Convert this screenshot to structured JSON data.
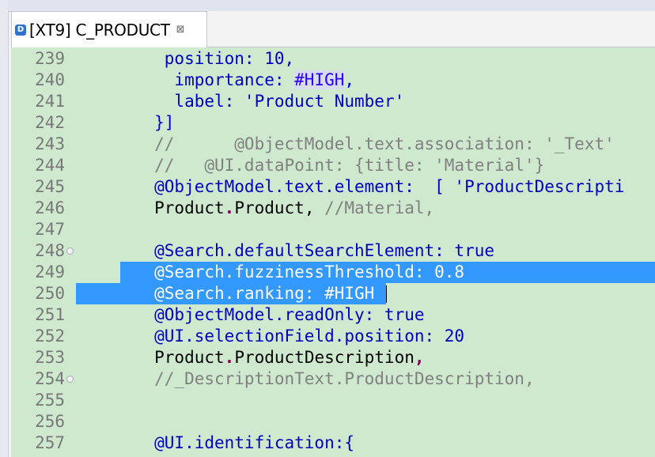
{
  "editor_tab": {
    "icon": "D",
    "icon_name": "ddl-source-icon",
    "title": "[XT9] C_PRODUCT",
    "close_glyph": "⊠"
  },
  "colors": {
    "editor_background": "#cfe9cf",
    "selection": "#3399ff",
    "keyword": "#2a00ff",
    "comment": "#808080",
    "line_number": "#787878"
  },
  "lines": [
    {
      "n": "239",
      "fold": false,
      "tokens": [
        {
          "t": "         position: 10,",
          "c": "t-kw"
        }
      ]
    },
    {
      "n": "240",
      "fold": false,
      "tokens": [
        {
          "t": "          importance: ",
          "c": "t-kw"
        },
        {
          "t": "#HIGH",
          "c": "t-enum"
        },
        {
          "t": ",",
          "c": "t-kw"
        }
      ]
    },
    {
      "n": "241",
      "fold": false,
      "tokens": [
        {
          "t": "          label: 'Product Number'",
          "c": "t-kw"
        }
      ]
    },
    {
      "n": "242",
      "fold": false,
      "tokens": [
        {
          "t": "        }]",
          "c": "t-kw"
        }
      ]
    },
    {
      "n": "243",
      "fold": false,
      "tokens": [
        {
          "t": "        //      @ObjectModel.text.association: '_Text'",
          "c": "t-com"
        }
      ]
    },
    {
      "n": "244",
      "fold": false,
      "tokens": [
        {
          "t": "        //   @UI.dataPoint: {title: 'Material'}",
          "c": "t-com"
        }
      ]
    },
    {
      "n": "245",
      "fold": false,
      "tokens": [
        {
          "t": "        @ObjectModel.text.element:  [ 'ProductDescripti",
          "c": "t-kw"
        }
      ]
    },
    {
      "n": "246",
      "fold": false,
      "tokens": [
        {
          "t": "        Product",
          "c": "t-plain"
        },
        {
          "t": ".",
          "c": "t-dot"
        },
        {
          "t": "Product",
          "c": "t-plain"
        },
        {
          "t": ", ",
          "c": "t-plain"
        },
        {
          "t": "//Material,",
          "c": "t-com"
        }
      ]
    },
    {
      "n": "247",
      "fold": false,
      "tokens": [
        {
          "t": "",
          "c": "t-plain"
        }
      ]
    },
    {
      "n": "248",
      "fold": true,
      "tokens": [
        {
          "t": "        @Search.defaultSearchElement: true",
          "c": "t-kw"
        }
      ]
    },
    {
      "n": "249",
      "fold": false,
      "tokens": [
        {
          "t": "        @Search.fuzzinessThreshold: 0.8",
          "c": "sel-text"
        }
      ]
    },
    {
      "n": "250",
      "fold": false,
      "tokens": [
        {
          "t": "        @Search.ranking: #HIGH",
          "c": "sel-text"
        }
      ]
    },
    {
      "n": "251",
      "fold": false,
      "tokens": [
        {
          "t": "        @ObjectModel.readOnly: true",
          "c": "t-kw"
        }
      ]
    },
    {
      "n": "252",
      "fold": false,
      "tokens": [
        {
          "t": "        @UI.selectionField.position: 20",
          "c": "t-kw"
        }
      ]
    },
    {
      "n": "253",
      "fold": false,
      "tokens": [
        {
          "t": "        Product",
          "c": "t-plain"
        },
        {
          "t": ".",
          "c": "t-dot"
        },
        {
          "t": "ProductDescription",
          "c": "t-plain"
        },
        {
          "t": ",",
          "c": "t-dot"
        }
      ]
    },
    {
      "n": "254",
      "fold": true,
      "tokens": [
        {
          "t": "        //_DescriptionText.ProductDescription,",
          "c": "t-com"
        }
      ]
    },
    {
      "n": "255",
      "fold": false,
      "tokens": [
        {
          "t": "",
          "c": "t-plain"
        }
      ]
    },
    {
      "n": "256",
      "fold": false,
      "tokens": [
        {
          "t": "",
          "c": "t-plain"
        }
      ]
    },
    {
      "n": "257",
      "fold": false,
      "tokens": [
        {
          "t": "        @UI.identification:{",
          "c": "t-kw"
        }
      ]
    }
  ]
}
